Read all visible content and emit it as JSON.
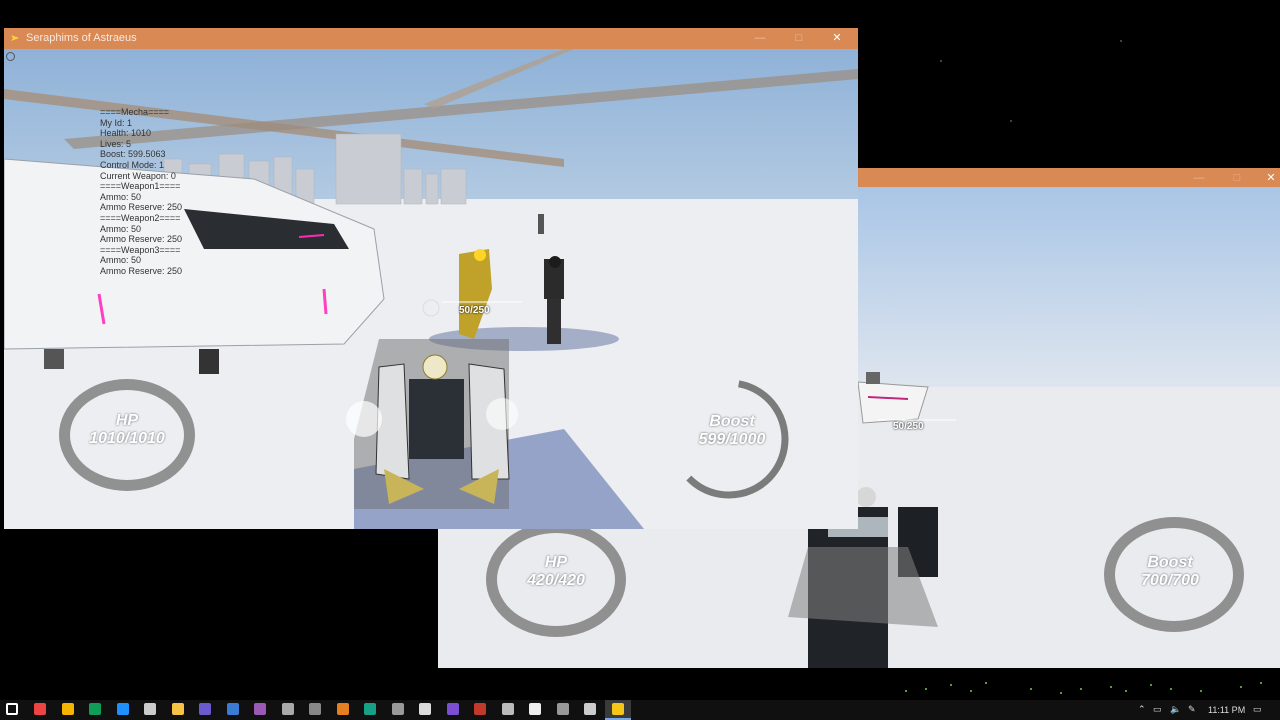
{
  "main_window": {
    "title": "Seraphims of Astraeus",
    "minimize": "—",
    "maximize": "□",
    "close": "✕"
  },
  "debug_panel": {
    "lines": [
      "====Mecha====",
      "My Id: 1",
      "Health: 1010",
      "Lives: 5",
      "Boost: 599.5063",
      "Control Mode: 1",
      "Current Weapon: 0",
      "====Weapon1====",
      "Ammo: 50",
      "Ammo Reserve: 250",
      "====Weapon2====",
      "Ammo: 50",
      "Ammo Reserve: 250",
      "====Weapon3====",
      "Ammo: 50",
      "Ammo Reserve: 250"
    ]
  },
  "player1_hud": {
    "hp_label": "HP",
    "hp_value": "1010/1010",
    "boost_label": "Boost",
    "boost_value": "599/1000",
    "boost_fraction": 0.599,
    "ammo": "50/250"
  },
  "player2_hud": {
    "hp_label": "HP",
    "hp_value": "420/420",
    "boost_label": "Boost",
    "boost_value": "700/700",
    "boost_fraction": 1.0,
    "ammo": "50/250"
  },
  "taskbar": {
    "time": "11:11 PM",
    "icons": [
      "windows-start-icon",
      "task-view-icon",
      "chrome-icon",
      "chrome-icon-2",
      "edge-icon",
      "app-icon",
      "folder-icon",
      "app-icon-2",
      "app-icon-3",
      "app-icon-4",
      "app-icon-5",
      "app-icon-6",
      "app-icon-7",
      "app-icon-8",
      "app-icon-9",
      "unity-icon",
      "visual-studio-icon",
      "app-icon-10",
      "git-icon",
      "search-icon",
      "obs-icon",
      "game-icon",
      "seraphims-icon"
    ]
  },
  "colors": {
    "titlebar": "#d98954",
    "ground": "#e8eaee",
    "sky": "#c8d8ea"
  }
}
